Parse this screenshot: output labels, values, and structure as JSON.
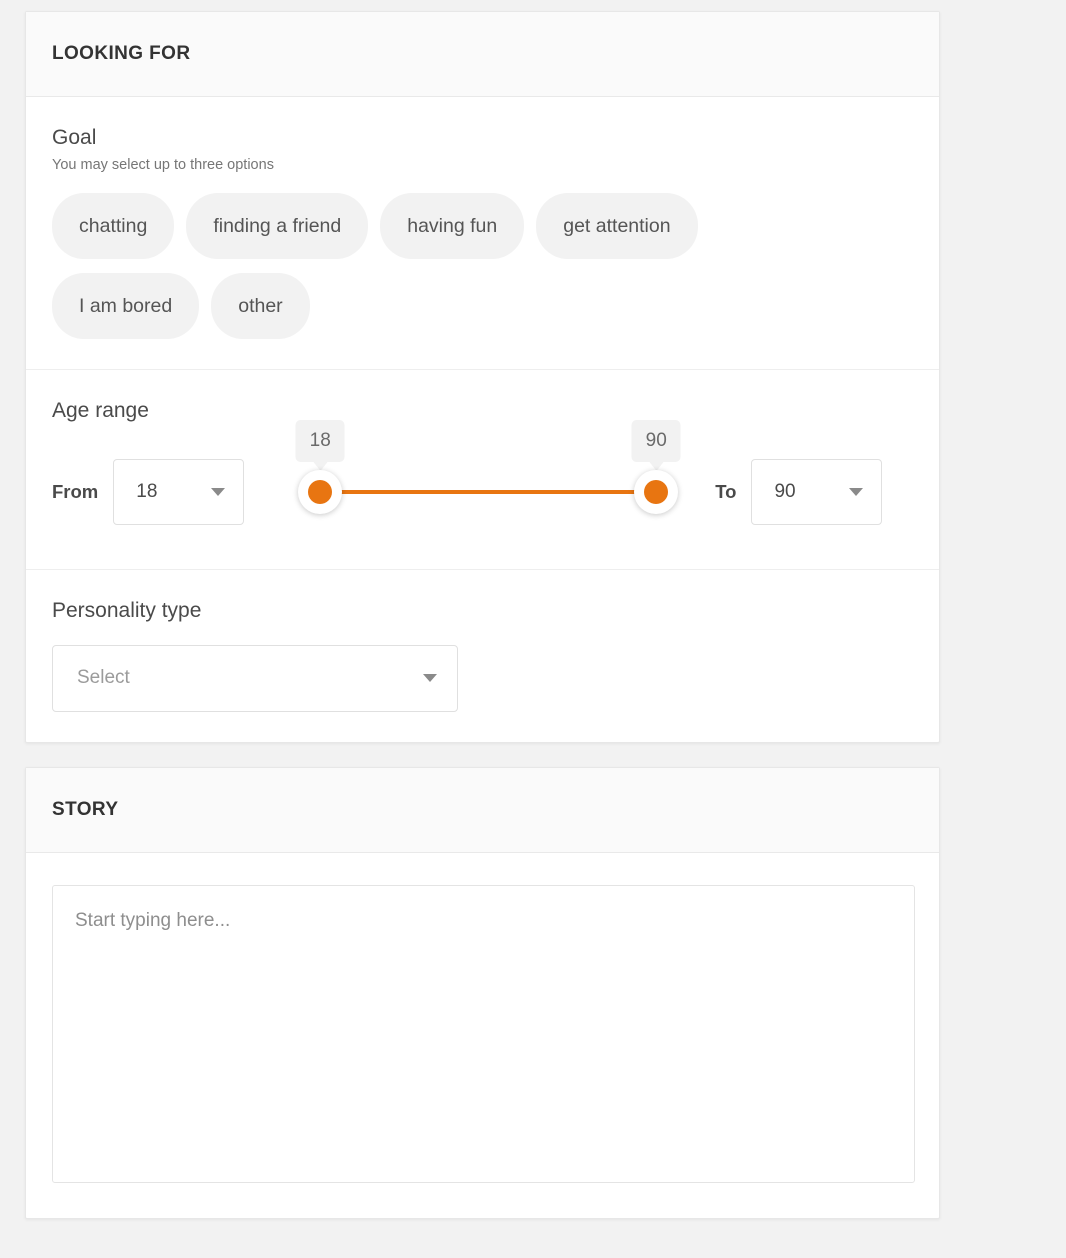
{
  "looking_for": {
    "header_title": "LOOKING FOR",
    "goal": {
      "label": "Goal",
      "hint": "You may select up to three options",
      "chips": [
        "chatting",
        "finding a friend",
        "having fun",
        "get attention",
        "I am bored",
        "other"
      ]
    },
    "age_range": {
      "label": "Age range",
      "from_label": "From",
      "to_label": "To",
      "from_value": "18",
      "to_value": "90",
      "slider_min_tooltip": "18",
      "slider_max_tooltip": "90",
      "accent_color": "#E87511"
    },
    "personality": {
      "label": "Personality type",
      "select_placeholder": "Select"
    }
  },
  "story": {
    "header_title": "STORY",
    "textarea_placeholder": "Start typing here...",
    "textarea_value": ""
  }
}
